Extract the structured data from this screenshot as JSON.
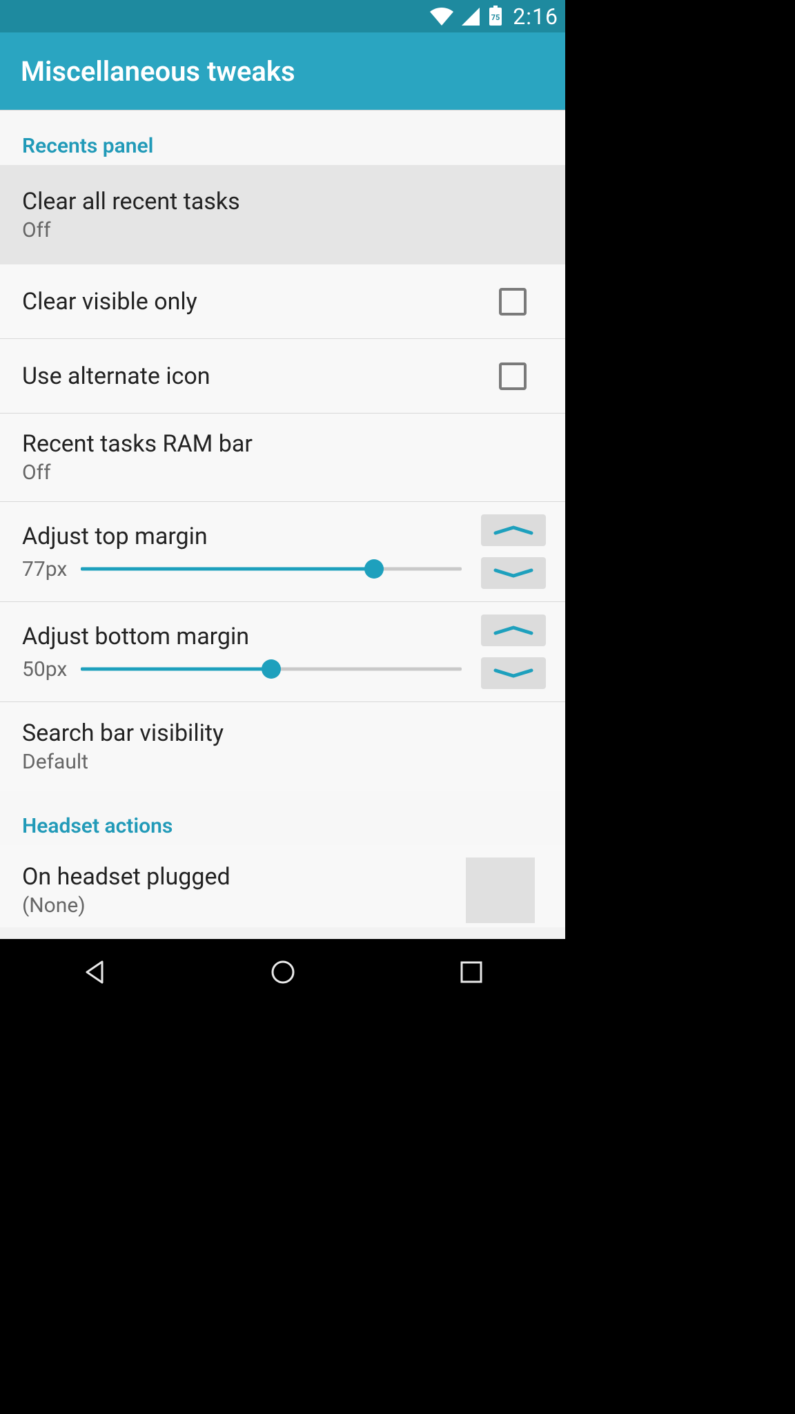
{
  "status": {
    "time": "2:16",
    "battery_pct": 75
  },
  "appbar": {
    "title": "Miscellaneous tweaks"
  },
  "sections": {
    "recents": {
      "header": "Recents panel",
      "clear_all": {
        "title": "Clear all recent tasks",
        "sub": "Off"
      },
      "clear_visible": {
        "title": "Clear visible only"
      },
      "alt_icon": {
        "title": "Use alternate icon"
      },
      "ram_bar": {
        "title": "Recent tasks RAM bar",
        "sub": "Off"
      },
      "top_margin": {
        "title": "Adjust top margin",
        "value_text": "77px",
        "value_pct": 77
      },
      "bottom_margin": {
        "title": "Adjust bottom margin",
        "value_text": "50px",
        "value_pct": 50
      },
      "search_bar": {
        "title": "Search bar visibility",
        "sub": "Default"
      }
    },
    "headset": {
      "header": "Headset actions",
      "on_plugged": {
        "title": "On headset plugged",
        "sub": "(None)"
      }
    }
  },
  "colors": {
    "accent": "#1ea0bd",
    "appbar": "#2aa5c1",
    "statusbar": "#1e8a9f"
  }
}
